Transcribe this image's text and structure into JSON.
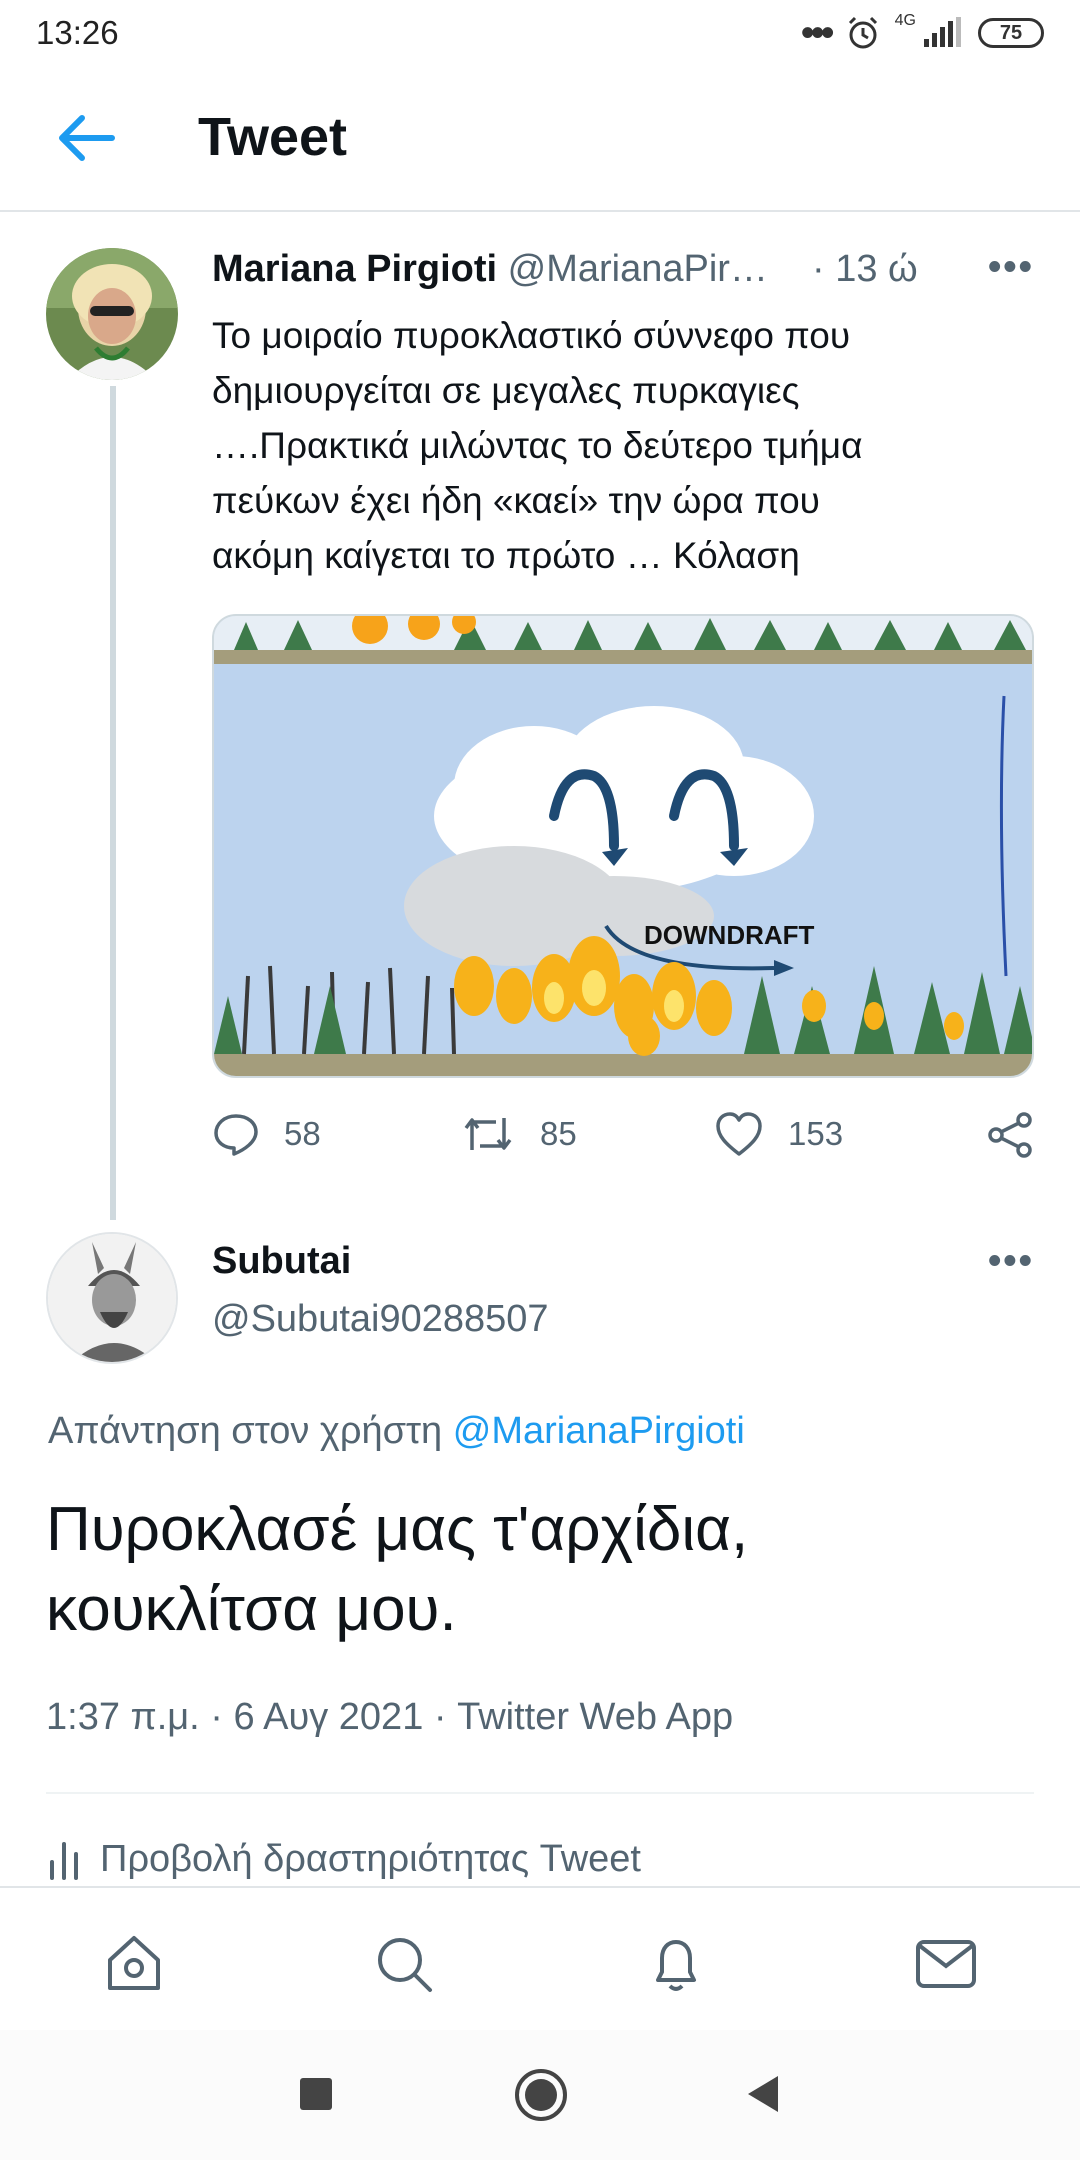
{
  "status": {
    "time": "13:26",
    "network": "4G",
    "battery": "75"
  },
  "header": {
    "title": "Tweet"
  },
  "tweet1": {
    "name": "Mariana Pirgioti",
    "handle": "@MarianaPir…",
    "time": "· 13 ώ",
    "text": "Το μοιραίο πυροκλαστικό σύννεφο που\nδημιουργείται σε μεγαλες πυρκαγιες\n….Πρακτικά μιλώντας το δεύτερο τμήμα\nπεύκων έχει ήδη  «καεί» την ώρα που\nακόμη καίγεται το πρώτο …  Κόλαση",
    "media_label": "DOWNDRAFT",
    "replies": "58",
    "retweets": "85",
    "likes": "153"
  },
  "tweet2": {
    "name": "Subutai",
    "handle": "@Subutai90288507",
    "replying_prefix": "Απάντηση στον χρήστη",
    "replying_handle": "@MarianaPirgioti",
    "text": "Πυροκλασέ μας τ'αρχίδια, κουκλίτσα μου.",
    "meta": "1:37 π.μ. · 6 Αυγ 2021 · Twitter Web App",
    "activity": "Προβολή δραστηριότητας Tweet"
  },
  "colors": {
    "accent": "#1d9bf0",
    "muted": "#536471",
    "text": "#0f1419"
  },
  "icons": [
    "back-arrow-icon",
    "more-icon",
    "reply-icon",
    "retweet-icon",
    "like-icon",
    "share-icon",
    "home-icon",
    "search-icon",
    "notifications-icon",
    "messages-icon",
    "activity-icon"
  ]
}
